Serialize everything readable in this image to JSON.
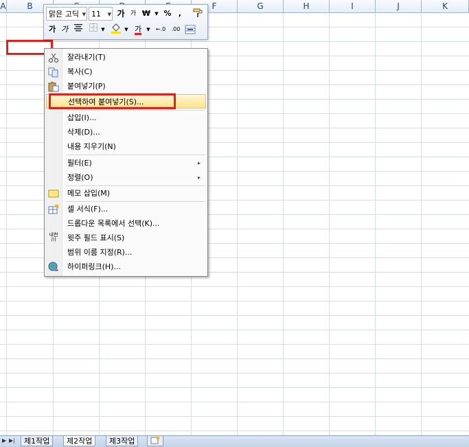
{
  "columns": [
    "A",
    "B",
    "C",
    "D",
    "E",
    "F",
    "G",
    "H",
    "I",
    "J",
    "K"
  ],
  "mini_toolbar": {
    "font_name": "맑은 고딕",
    "font_size": "11",
    "grow_font": "가",
    "shrink_font": "가",
    "currency": "₩",
    "percent": "%",
    "comma": ",",
    "bold": "가",
    "italic": "가",
    "font_color_label": "가",
    "increase_decimal": "←.0",
    "decrease_decimal": ".00",
    "accent_red": "#e0201a"
  },
  "context_menu": {
    "items": [
      {
        "label": "잘라내기(T)",
        "icon": "scissors-icon"
      },
      {
        "label": "복사(C)",
        "icon": "copy-icon"
      },
      {
        "label": "붙여넣기(P)",
        "icon": "paste-icon"
      },
      {
        "label": "선택하여 붙여넣기(S)...",
        "icon": ""
      },
      {
        "label": "삽입(I)...",
        "icon": ""
      },
      {
        "label": "삭제(D)...",
        "icon": ""
      },
      {
        "label": "내용 지우기(N)",
        "icon": ""
      },
      {
        "label": "필터(E)",
        "icon": ""
      },
      {
        "label": "정렬(O)",
        "icon": ""
      },
      {
        "label": "메모 삽입(M)",
        "icon": "comment-icon"
      },
      {
        "label": "셀 서식(F)...",
        "icon": "format-cells-icon"
      },
      {
        "label": "드롭다운 목록에서 선택(K)...",
        "icon": ""
      },
      {
        "label": "윗주 필드 표시(S)",
        "icon": "phonetic-icon"
      },
      {
        "label": "범위 이름 지정(R)...",
        "icon": ""
      },
      {
        "label": "하이퍼링크(H)...",
        "icon": "hyperlink-icon"
      }
    ],
    "phonetic_icon_text": "내천\n川",
    "submenu_arrow": "▸"
  },
  "sheet_tabs": [
    "제1작업",
    "제2작업",
    "제3작업"
  ],
  "active_tab": "제2작업",
  "annotation_color": "#e0201a"
}
